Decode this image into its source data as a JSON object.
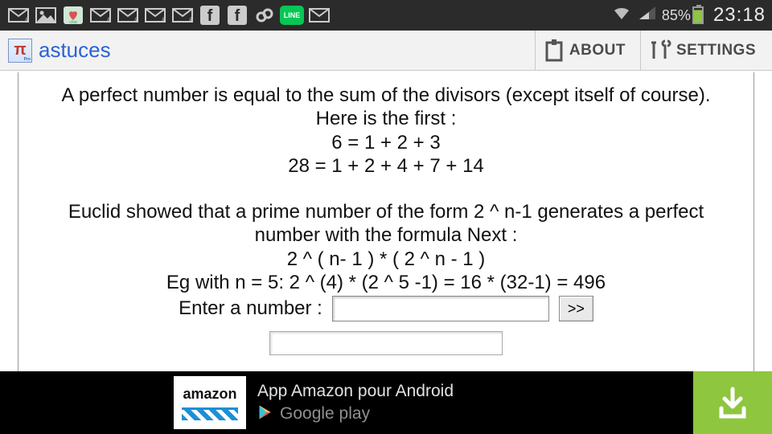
{
  "statusbar": {
    "battery_percent": "85%",
    "clock": "23:18",
    "line_label": "LINE"
  },
  "appbar": {
    "pi_symbol": "π",
    "title": "astuces",
    "about": "ABOUT",
    "settings": "SETTINGS"
  },
  "content": {
    "p1": "A perfect number is equal to the sum of the divisors (except itself of course).",
    "p2": "Here is the first :",
    "eq1": "6 = 1 + 2 + 3",
    "eq2": "28 = 1 + 2 + 4 + 7 + 14",
    "p3": "Euclid showed that a prime number of the form 2 ^ n-1 generates a perfect number with the formula Next :",
    "formula": "2 ^ ( n- 1 ) * ( 2 ^ n - 1 )",
    "example": "Eg with n = 5: 2 ^ (4) * (2 ^ 5 -1) = 16 * (32-1) = 496",
    "input_label": "Enter a number :",
    "input_value": "",
    "go_label": ">>"
  },
  "ad": {
    "amazon": "amazon",
    "line1": "App Amazon pour Android",
    "gplay": "Google play"
  }
}
